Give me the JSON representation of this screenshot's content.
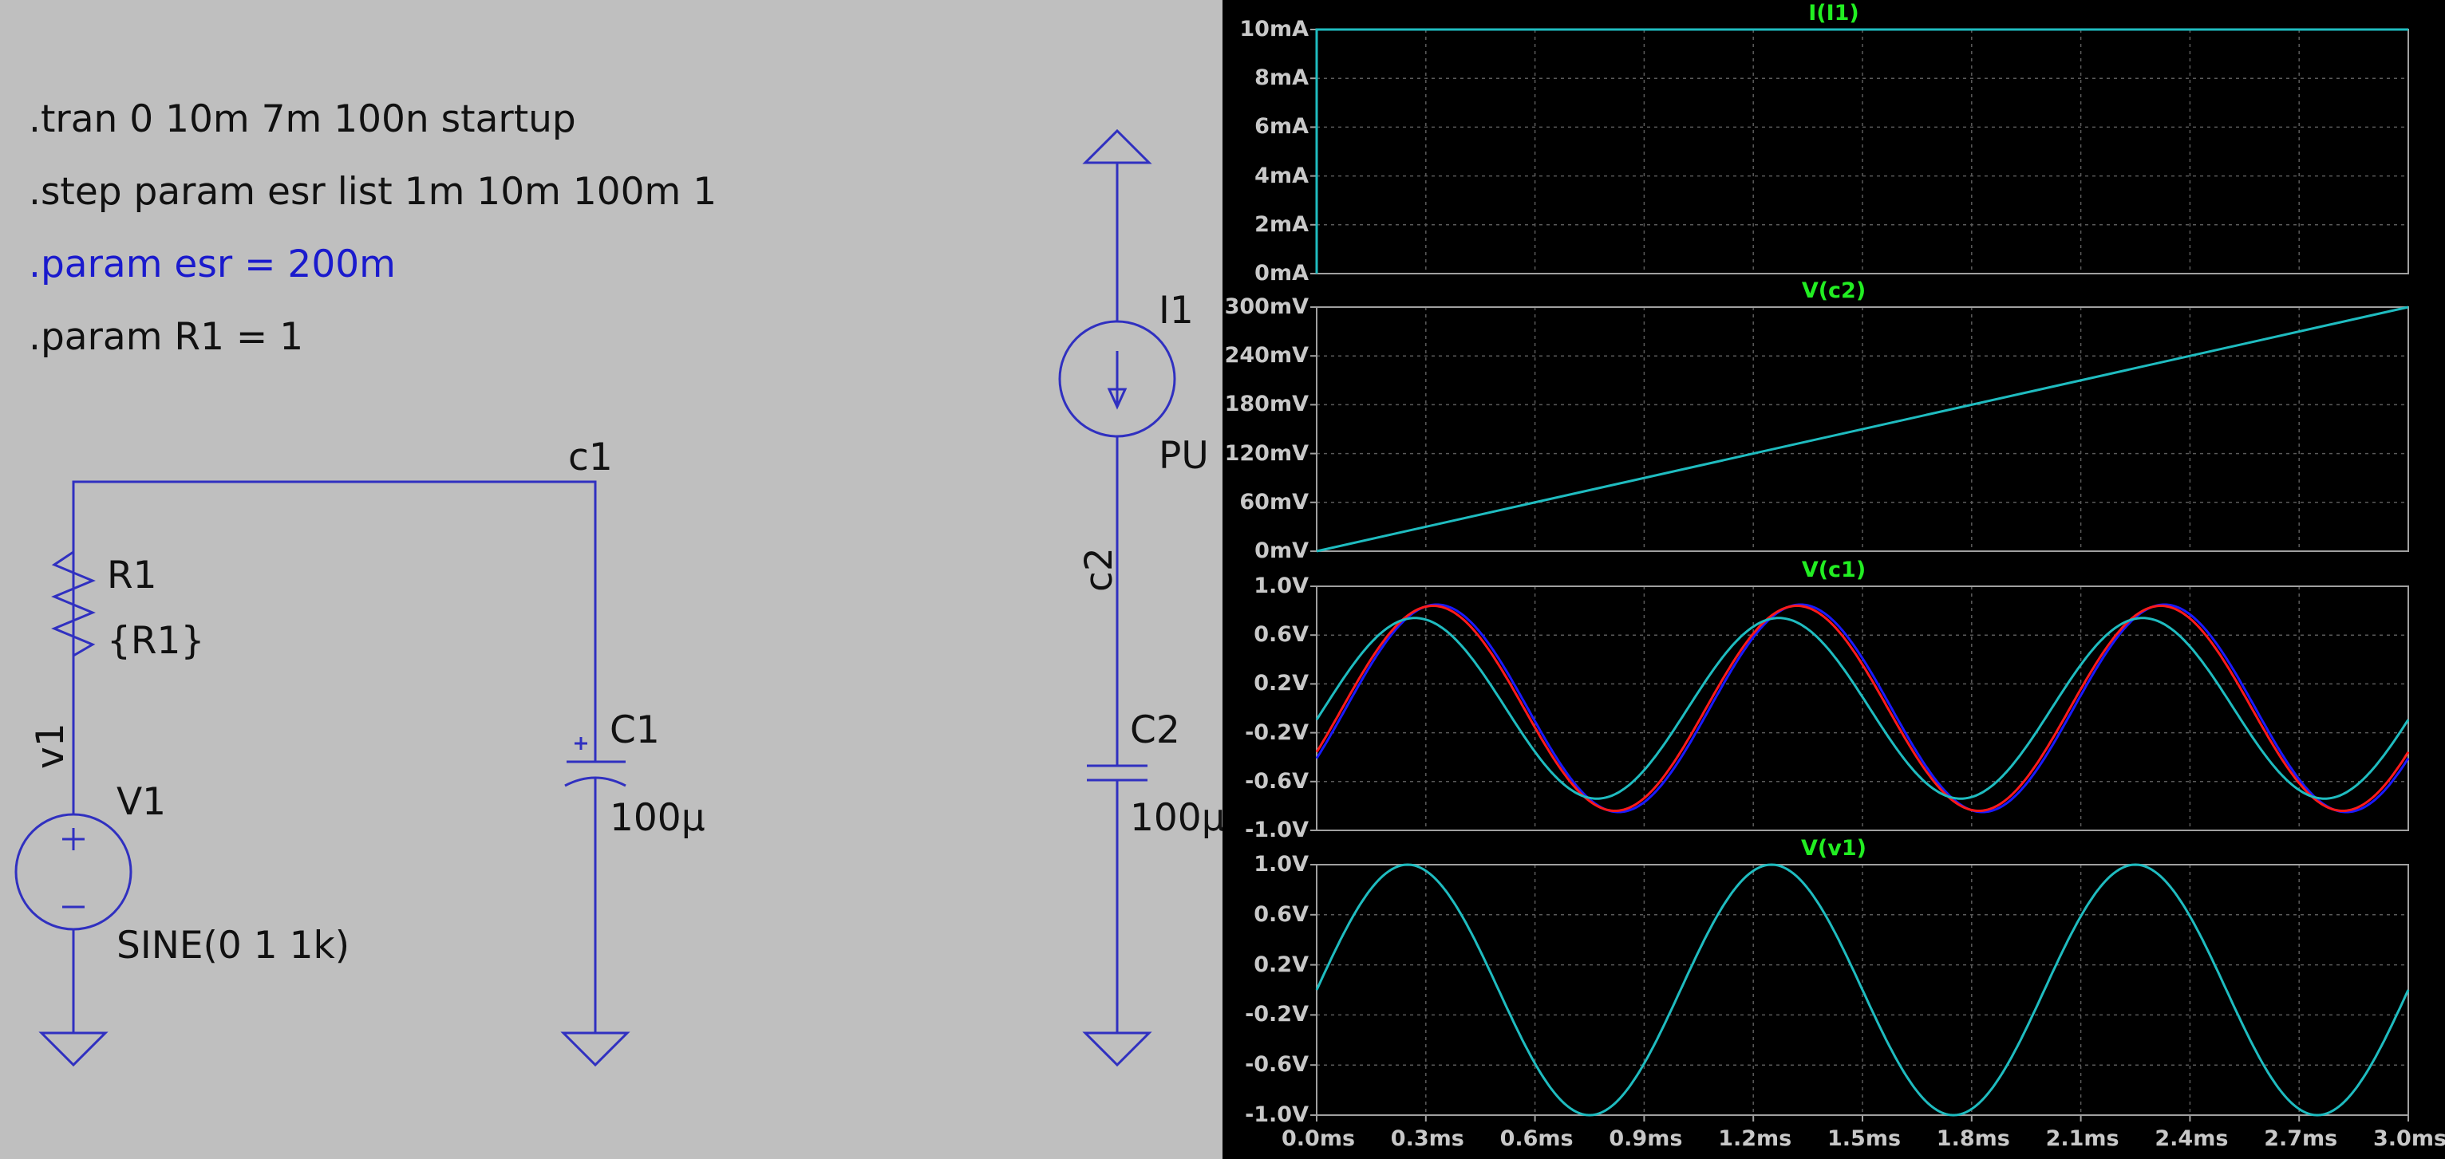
{
  "schematic": {
    "directives": [
      {
        "text": ".tran 0 10m 7m 100n startup",
        "active": false
      },
      {
        "text": ".step param esr list 1m 10m 100m 1",
        "active": false
      },
      {
        "text": ".param esr = 200m",
        "active": true
      },
      {
        "text": ".param R1 = 1",
        "active": false
      }
    ],
    "net_labels": {
      "c1": "c1",
      "c2": "c2",
      "v1": "v1"
    },
    "components": {
      "R1": {
        "name": "R1",
        "value": "{R1}"
      },
      "V1": {
        "name": "V1",
        "value": "SINE(0 1 1k)"
      },
      "C1": {
        "name": "C1",
        "value": "100µ"
      },
      "C2": {
        "name": "C2",
        "value": "100µ"
      },
      "I1": {
        "name": "I1",
        "value": "PU"
      }
    },
    "colors": {
      "wire": "#3030c0",
      "background": "#bfbfbf",
      "active_directive": "#1a1acd"
    }
  },
  "waveform_viewer": {
    "background": "#000000",
    "title_color": "#22ee22",
    "x_ticks": [
      "0.0ms",
      "0.3ms",
      "0.6ms",
      "0.9ms",
      "1.2ms",
      "1.5ms",
      "1.8ms",
      "2.1ms",
      "2.4ms",
      "2.7ms",
      "3.0ms"
    ]
  },
  "chart_data": [
    {
      "type": "line",
      "title": "I(I1)",
      "x_range": [
        0,
        3.0
      ],
      "ylim": [
        0,
        10
      ],
      "y_ticks": [
        "10mA",
        "8mA",
        "6mA",
        "4mA",
        "2mA",
        "0mA"
      ],
      "series": [
        {
          "color": "#1fbcc0",
          "x": [
            0,
            0.0001,
            3.0
          ],
          "values": [
            0,
            10,
            10
          ]
        }
      ]
    },
    {
      "type": "line",
      "title": "V(c2)",
      "x_range": [
        0,
        3.0
      ],
      "ylim": [
        0,
        300
      ],
      "y_ticks": [
        "300mV",
        "240mV",
        "180mV",
        "120mV",
        "60mV",
        "0mV"
      ],
      "series": [
        {
          "color": "#1fbcc0",
          "x": [
            0,
            3.0
          ],
          "values": [
            0,
            300
          ]
        }
      ]
    },
    {
      "type": "line",
      "title": "V(c1)",
      "x_range": [
        0,
        3.0
      ],
      "ylim": [
        -1.0,
        1.0
      ],
      "y_ticks": [
        "1.0V",
        "0.6V",
        "0.2V",
        "-0.2V",
        "-0.6V",
        "-1.0V"
      ],
      "series": [
        {
          "color": "#1a1aff",
          "amplitude": 0.85,
          "peak_times_ms": [
            0.33,
            1.33,
            2.33
          ]
        },
        {
          "color": "#ff1a1a",
          "amplitude": 0.84,
          "peak_times_ms": [
            0.32,
            1.32,
            2.32
          ]
        },
        {
          "color": "#1fbcc0",
          "amplitude": 0.74,
          "peak_times_ms": [
            0.27,
            1.27,
            2.27
          ]
        }
      ]
    },
    {
      "type": "line",
      "title": "V(v1)",
      "x_range": [
        0,
        3.0
      ],
      "ylim": [
        -1.0,
        1.0
      ],
      "y_ticks": [
        "1.0V",
        "0.6V",
        "0.2V",
        "-0.2V",
        "-0.6V",
        "-1.0V"
      ],
      "series": [
        {
          "color": "#1fbcc0",
          "amplitude": 1.0,
          "peak_times_ms": [
            0.25,
            1.25,
            2.25
          ]
        }
      ]
    }
  ]
}
